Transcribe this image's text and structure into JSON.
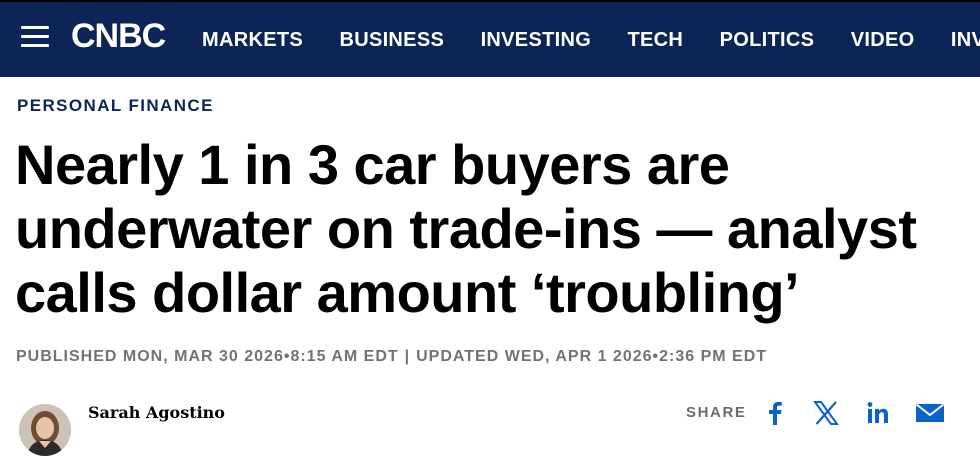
{
  "header": {
    "logo_text": "CNBC",
    "nav_items": [
      "MARKETS",
      "BUSINESS",
      "INVESTING",
      "TECH",
      "POLITICS",
      "VIDEO",
      "INVESTING CLUB"
    ]
  },
  "article": {
    "section": "PERSONAL FINANCE",
    "headline": "Nearly 1 in 3 car buyers are underwater on trade-ins — analyst calls dollar amount ‘troubling’",
    "published": "PUBLISHED MON, MAR 30 2026•8:15 AM EDT",
    "updated": "UPDATED WED, APR 1 2026•2:36 PM EDT",
    "separator": "|",
    "author": "Sarah Agostino"
  },
  "share": {
    "label": "SHARE",
    "icons": [
      "facebook-icon",
      "x-icon",
      "linkedin-icon",
      "email-icon"
    ]
  },
  "colors": {
    "header_bg": "#0d2456",
    "section_text": "#0d2456",
    "icon_blue": "#0a63c9",
    "meta_gray": "#737373"
  }
}
